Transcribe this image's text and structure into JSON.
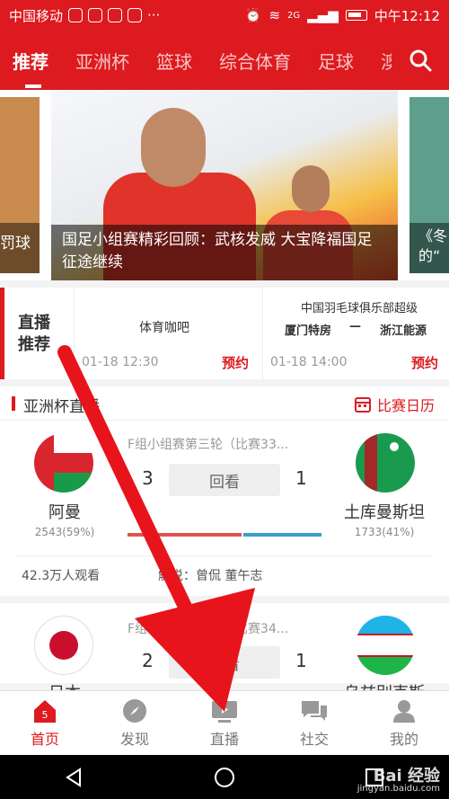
{
  "status_bar": {
    "carrier": "中国移动",
    "dots": "···",
    "signal": "2G",
    "time": "中午12:12"
  },
  "top_nav": {
    "tabs": [
      "推荐",
      "亚洲杯",
      "篮球",
      "综合体育",
      "足球",
      "澳"
    ],
    "active_tab": 0
  },
  "banner": {
    "left_caption": "罚球",
    "main_caption": "国足小组赛精彩回顾：武核发威 大宝降福国足征途继续",
    "right_caption": "《冬的“"
  },
  "live_recommend": {
    "tag": "直播推荐",
    "cards": [
      {
        "title": "体育咖吧",
        "time": "01-18 12:30",
        "action": "预约"
      },
      {
        "title": "中国羽毛球俱乐部超级",
        "team_a": "厦门特房",
        "vs": "—",
        "team_b": "浙江能源",
        "time": "01-18 14:00",
        "action": "预约"
      }
    ]
  },
  "asia_cup": {
    "section_title": "亚洲杯直播",
    "calendar_label": "比赛日历",
    "matches": [
      {
        "title": "F组小组赛第三轮（比赛33...",
        "home_name": "阿曼",
        "home_pct": "2543(59%)",
        "home_score": "3",
        "away_name": "土库曼斯坦",
        "away_pct": "1733(41%)",
        "away_score": "1",
        "replay_label": "回看",
        "home_share": 0.59,
        "viewers": "42.3万人观看",
        "commentary": "解说：曾侃 董午志"
      },
      {
        "title": "F组小组赛第三轮（比赛34...",
        "home_name": "日本",
        "home_score": "2",
        "away_name": "乌兹别克斯",
        "away_score": "1",
        "replay_label": "回看"
      }
    ]
  },
  "bottom_nav": {
    "items": [
      "首页",
      "发现",
      "直播",
      "社交",
      "我的"
    ],
    "active": 0,
    "badge": "5"
  },
  "watermark": {
    "brand": "Bai 经验",
    "url": "jingyan.baidu.com"
  },
  "colors": {
    "brand_red": "#dd1a1f",
    "home_bar": "#e0534f",
    "away_bar": "#3aa0c8"
  }
}
